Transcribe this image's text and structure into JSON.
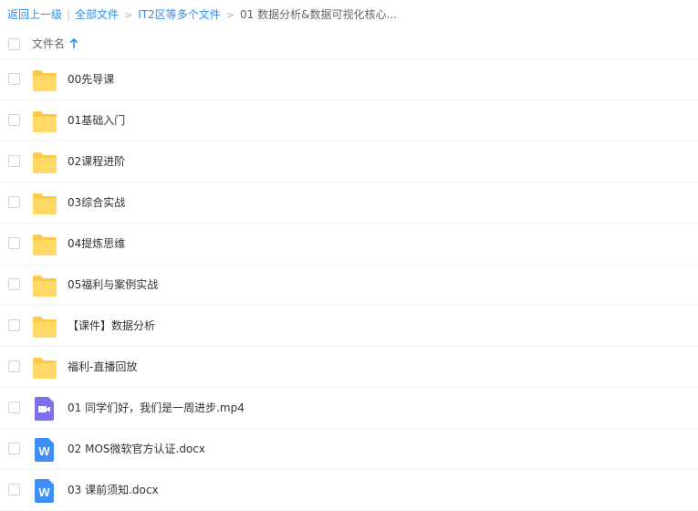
{
  "breadcrumb": {
    "back": "返回上一级",
    "separator_bar": "|",
    "all_files": "全部文件",
    "separator_gt": ">",
    "level1": "IT2区等多个文件",
    "current": "01 数据分析&数据可视化核心..."
  },
  "header": {
    "column_label": "文件名",
    "sort": "ascending"
  },
  "colors": {
    "link": "#2b8ff2",
    "folder": "#ffd35c",
    "video": "#7b71e8",
    "doc": "#3f8ef7"
  },
  "files": [
    {
      "name": "00先导课",
      "type": "folder",
      "icon": "folder-icon"
    },
    {
      "name": "01基础入门",
      "type": "folder",
      "icon": "folder-icon"
    },
    {
      "name": "02课程进阶",
      "type": "folder",
      "icon": "folder-icon"
    },
    {
      "name": "03综合实战",
      "type": "folder",
      "icon": "folder-icon"
    },
    {
      "name": "04提炼思维",
      "type": "folder",
      "icon": "folder-icon"
    },
    {
      "name": "05福利与案例实战",
      "type": "folder",
      "icon": "folder-icon"
    },
    {
      "name": "【课件】数据分析",
      "type": "folder",
      "icon": "folder-icon"
    },
    {
      "name": "福利-直播回放",
      "type": "folder",
      "icon": "folder-icon"
    },
    {
      "name": "01 同学们好，我们是一周进步.mp4",
      "type": "video",
      "icon": "video-file-icon"
    },
    {
      "name": "02 MOS微软官方认证.docx",
      "type": "word",
      "icon": "word-file-icon"
    },
    {
      "name": "03 课前须知.docx",
      "type": "word",
      "icon": "word-file-icon"
    }
  ]
}
